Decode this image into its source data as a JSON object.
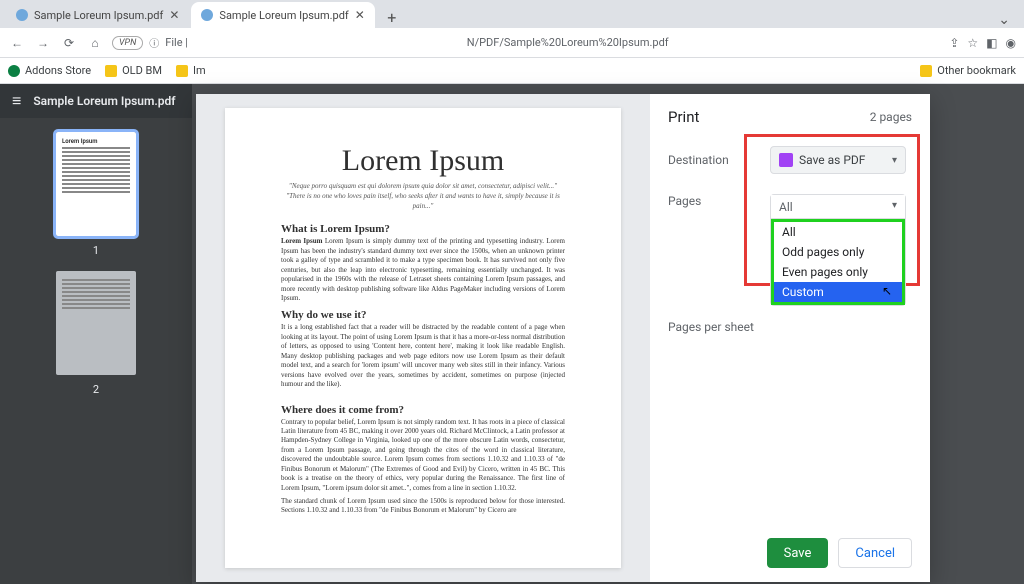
{
  "browser": {
    "tabs": [
      {
        "title": "Sample Loreum Ipsum.pdf"
      },
      {
        "title": "Sample Loreum Ipsum.pdf"
      }
    ],
    "url_placeholder": "File |",
    "url_path": "N/PDF/Sample%20Loreum%20Ipsum.pdf",
    "bookmarks": {
      "addons": "Addons Store",
      "oldbm": "OLD BM",
      "im": "Im",
      "other": "Other bookmark"
    }
  },
  "viewer": {
    "title": "Sample Loreum Ipsum.pdf",
    "thumb_title": "Lorem Ipsum",
    "page1": "1",
    "page2": "2"
  },
  "doc": {
    "h1": "Lorem Ipsum",
    "sub1": "\"Neque porro quisquam est qui dolorem ipsum quia dolor sit amet, consectetur, adipisci velit...\"",
    "sub2": "\"There is no one who loves pain itself, who seeks after it and wants to have it, simply because it is pain...\"",
    "s1": "What is Lorem Ipsum?",
    "p1": "Lorem Ipsum is simply dummy text of the printing and typesetting industry. Lorem Ipsum has been the industry's standard dummy text ever since the 1500s, when an unknown printer took a galley of type and scrambled it to make a type specimen book. It has survived not only five centuries, but also the leap into electronic typesetting, remaining essentially unchanged. It was popularised in the 1960s with the release of Letraset sheets containing Lorem Ipsum passages, and more recently with desktop publishing software like Aldus PageMaker including versions of Lorem Ipsum.",
    "s2": "Why do we use it?",
    "p2": "It is a long established fact that a reader will be distracted by the readable content of a page when looking at its layout. The point of using Lorem Ipsum is that it has a more-or-less normal distribution of letters, as opposed to using 'Content here, content here', making it look like readable English. Many desktop publishing packages and web page editors now use Lorem Ipsum as their default model text, and a search for 'lorem ipsum' will uncover many web sites still in their infancy. Various versions have evolved over the years, sometimes by accident, sometimes on purpose (injected humour and the like).",
    "s3": "Where does it come from?",
    "p3": "Contrary to popular belief, Lorem Ipsum is not simply random text. It has roots in a piece of classical Latin literature from 45 BC, making it over 2000 years old. Richard McClintock, a Latin professor at Hampden-Sydney College in Virginia, looked up one of the more obscure Latin words, consectetur, from a Lorem Ipsum passage, and going through the cites of the word in classical literature, discovered the undoubtable source. Lorem Ipsum comes from sections 1.10.32 and 1.10.33 of \"de Finibus Bonorum et Malorum\" (The Extremes of Good and Evil) by Cicero, written in 45 BC. This book is a treatise on the theory of ethics, very popular during the Renaissance. The first line of Lorem Ipsum, \"Lorem ipsum dolor sit amet..\", comes from a line in section 1.10.32.",
    "p4": "The standard chunk of Lorem Ipsum used since the 1500s is reproduced below for those interested. Sections 1.10.32 and 1.10.33 from \"de Finibus Bonorum et Malorum\" by Cicero are"
  },
  "background_text": "sometimes on purpose (injected humour and the like).",
  "print": {
    "title": "Print",
    "count": "2 pages",
    "rows": {
      "destination": "Destination",
      "pages": "Pages",
      "pps": "Pages per sheet"
    },
    "destination_value": "Save as PDF",
    "pages_selected": "All",
    "pages_options": {
      "all": "All",
      "odd": "Odd pages only",
      "even": "Even pages only",
      "custom": "Custom"
    },
    "save": "Save",
    "cancel": "Cancel"
  }
}
